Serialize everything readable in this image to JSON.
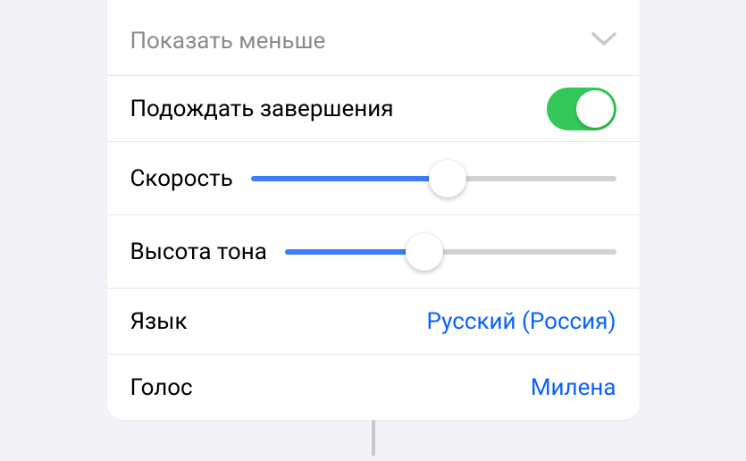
{
  "header": {
    "show_less_label": "Показать меньше"
  },
  "rows": {
    "wait_label": "Подождать завершения",
    "wait_enabled": true,
    "speed_label": "Скорость",
    "speed_value": 0.54,
    "pitch_label": "Высота тона",
    "pitch_value": 0.42,
    "language_label": "Язык",
    "language_value": "Русский (Россия)",
    "voice_label": "Голос",
    "voice_value": "Милена"
  },
  "colors": {
    "accent_blue": "#0a61ff",
    "toggle_green": "#34c759",
    "slider_blue": "#3c7cff"
  }
}
